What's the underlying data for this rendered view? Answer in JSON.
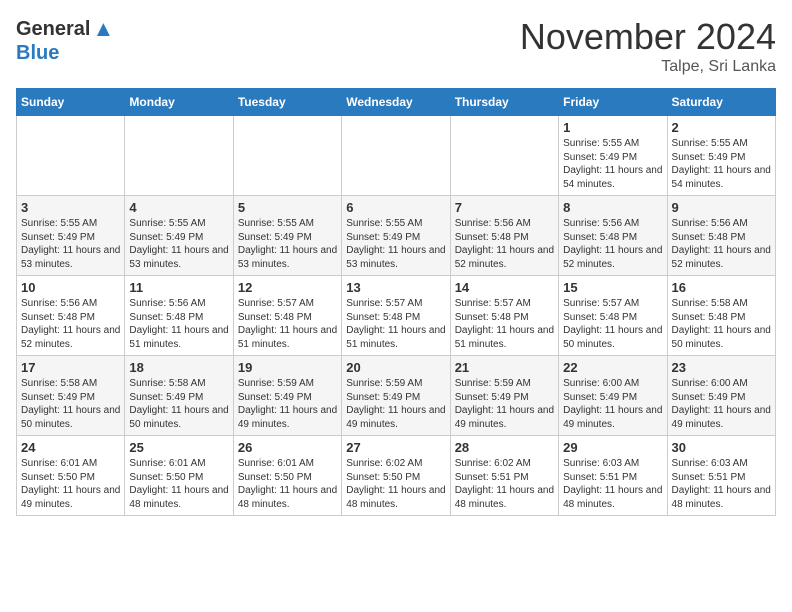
{
  "header": {
    "logo_general": "General",
    "logo_blue": "Blue",
    "month": "November 2024",
    "location": "Talpe, Sri Lanka"
  },
  "days_of_week": [
    "Sunday",
    "Monday",
    "Tuesday",
    "Wednesday",
    "Thursday",
    "Friday",
    "Saturday"
  ],
  "weeks": [
    [
      {
        "day": "",
        "info": ""
      },
      {
        "day": "",
        "info": ""
      },
      {
        "day": "",
        "info": ""
      },
      {
        "day": "",
        "info": ""
      },
      {
        "day": "",
        "info": ""
      },
      {
        "day": "1",
        "info": "Sunrise: 5:55 AM\nSunset: 5:49 PM\nDaylight: 11 hours and 54 minutes."
      },
      {
        "day": "2",
        "info": "Sunrise: 5:55 AM\nSunset: 5:49 PM\nDaylight: 11 hours and 54 minutes."
      }
    ],
    [
      {
        "day": "3",
        "info": "Sunrise: 5:55 AM\nSunset: 5:49 PM\nDaylight: 11 hours and 53 minutes."
      },
      {
        "day": "4",
        "info": "Sunrise: 5:55 AM\nSunset: 5:49 PM\nDaylight: 11 hours and 53 minutes."
      },
      {
        "day": "5",
        "info": "Sunrise: 5:55 AM\nSunset: 5:49 PM\nDaylight: 11 hours and 53 minutes."
      },
      {
        "day": "6",
        "info": "Sunrise: 5:55 AM\nSunset: 5:49 PM\nDaylight: 11 hours and 53 minutes."
      },
      {
        "day": "7",
        "info": "Sunrise: 5:56 AM\nSunset: 5:48 PM\nDaylight: 11 hours and 52 minutes."
      },
      {
        "day": "8",
        "info": "Sunrise: 5:56 AM\nSunset: 5:48 PM\nDaylight: 11 hours and 52 minutes."
      },
      {
        "day": "9",
        "info": "Sunrise: 5:56 AM\nSunset: 5:48 PM\nDaylight: 11 hours and 52 minutes."
      }
    ],
    [
      {
        "day": "10",
        "info": "Sunrise: 5:56 AM\nSunset: 5:48 PM\nDaylight: 11 hours and 52 minutes."
      },
      {
        "day": "11",
        "info": "Sunrise: 5:56 AM\nSunset: 5:48 PM\nDaylight: 11 hours and 51 minutes."
      },
      {
        "day": "12",
        "info": "Sunrise: 5:57 AM\nSunset: 5:48 PM\nDaylight: 11 hours and 51 minutes."
      },
      {
        "day": "13",
        "info": "Sunrise: 5:57 AM\nSunset: 5:48 PM\nDaylight: 11 hours and 51 minutes."
      },
      {
        "day": "14",
        "info": "Sunrise: 5:57 AM\nSunset: 5:48 PM\nDaylight: 11 hours and 51 minutes."
      },
      {
        "day": "15",
        "info": "Sunrise: 5:57 AM\nSunset: 5:48 PM\nDaylight: 11 hours and 50 minutes."
      },
      {
        "day": "16",
        "info": "Sunrise: 5:58 AM\nSunset: 5:48 PM\nDaylight: 11 hours and 50 minutes."
      }
    ],
    [
      {
        "day": "17",
        "info": "Sunrise: 5:58 AM\nSunset: 5:49 PM\nDaylight: 11 hours and 50 minutes."
      },
      {
        "day": "18",
        "info": "Sunrise: 5:58 AM\nSunset: 5:49 PM\nDaylight: 11 hours and 50 minutes."
      },
      {
        "day": "19",
        "info": "Sunrise: 5:59 AM\nSunset: 5:49 PM\nDaylight: 11 hours and 49 minutes."
      },
      {
        "day": "20",
        "info": "Sunrise: 5:59 AM\nSunset: 5:49 PM\nDaylight: 11 hours and 49 minutes."
      },
      {
        "day": "21",
        "info": "Sunrise: 5:59 AM\nSunset: 5:49 PM\nDaylight: 11 hours and 49 minutes."
      },
      {
        "day": "22",
        "info": "Sunrise: 6:00 AM\nSunset: 5:49 PM\nDaylight: 11 hours and 49 minutes."
      },
      {
        "day": "23",
        "info": "Sunrise: 6:00 AM\nSunset: 5:49 PM\nDaylight: 11 hours and 49 minutes."
      }
    ],
    [
      {
        "day": "24",
        "info": "Sunrise: 6:01 AM\nSunset: 5:50 PM\nDaylight: 11 hours and 49 minutes."
      },
      {
        "day": "25",
        "info": "Sunrise: 6:01 AM\nSunset: 5:50 PM\nDaylight: 11 hours and 48 minutes."
      },
      {
        "day": "26",
        "info": "Sunrise: 6:01 AM\nSunset: 5:50 PM\nDaylight: 11 hours and 48 minutes."
      },
      {
        "day": "27",
        "info": "Sunrise: 6:02 AM\nSunset: 5:50 PM\nDaylight: 11 hours and 48 minutes."
      },
      {
        "day": "28",
        "info": "Sunrise: 6:02 AM\nSunset: 5:51 PM\nDaylight: 11 hours and 48 minutes."
      },
      {
        "day": "29",
        "info": "Sunrise: 6:03 AM\nSunset: 5:51 PM\nDaylight: 11 hours and 48 minutes."
      },
      {
        "day": "30",
        "info": "Sunrise: 6:03 AM\nSunset: 5:51 PM\nDaylight: 11 hours and 48 minutes."
      }
    ]
  ]
}
